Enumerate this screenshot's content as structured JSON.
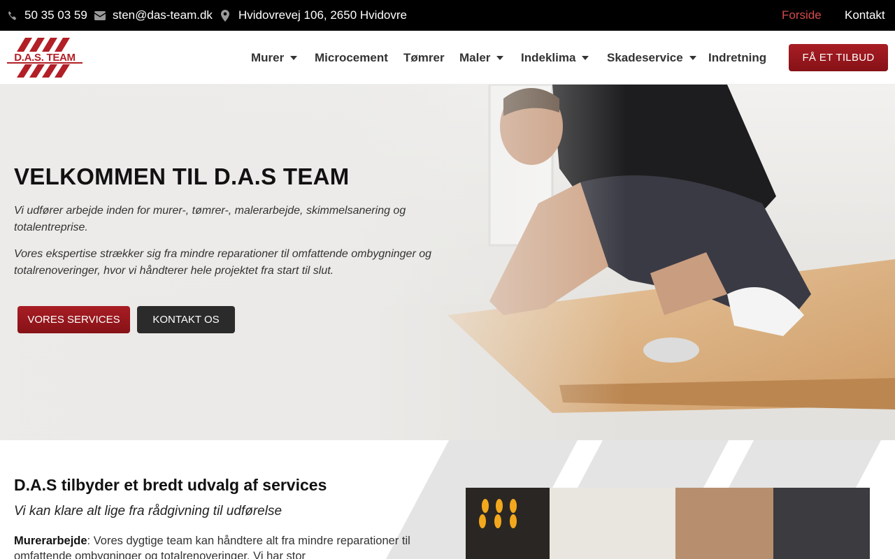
{
  "topbar": {
    "phone": "50 35 03 59",
    "email": "sten@das-team.dk",
    "address": "Hvidovrevej 106, 2650 Hvidovre",
    "links": [
      "Forside",
      "Kontakt"
    ]
  },
  "header": {
    "logo_text": "D.A.S. TEAM",
    "nav": [
      "Murer",
      "Microcement",
      "Tømrer",
      "Maler",
      "Indeklima",
      "Skadeservice",
      "Indretning"
    ],
    "cta": "FÅ ET TILBUD"
  },
  "hero": {
    "title": "VELKOMMEN TIL D.A.S TEAM",
    "p1": "Vi udfører arbejde inden for murer-, tømrer-, malerarbejde, skimmelsanering og totalentreprise.",
    "p2": "Vores ekspertise strækker sig fra mindre reparationer til omfattende ombygninger og totalrenoveringer, hvor vi håndterer hele projektet fra start til slut.",
    "btn_services": "VORES SERVICES",
    "btn_contact": "KONTAKT OS"
  },
  "services": {
    "title": "D.A.S tilbyder et bredt udvalg af services",
    "subtitle": "Vi kan klare alt lige fra rådgivning til udførelse",
    "body_label": "Murerarbejde",
    "body_text": ": Vores dygtige team kan håndtere alt fra mindre reparationer til omfattende ombygninger og totalrenoveringer. Vi har stor"
  },
  "colors": {
    "brand_red": "#a81d24",
    "active_link": "#d44a4a",
    "dark_button": "#2b2b2b"
  },
  "icons": [
    "phone-icon",
    "envelope-icon",
    "map-marker-icon",
    "caret-down-icon"
  ]
}
